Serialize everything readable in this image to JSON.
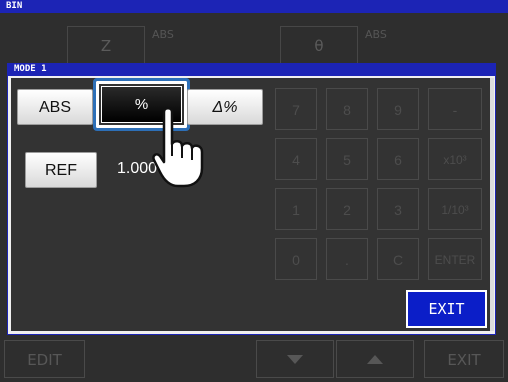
{
  "window": {
    "title": "BIN"
  },
  "background": {
    "param1": {
      "label": "Z",
      "mode": "ABS"
    },
    "param2": {
      "label": "θ",
      "mode": "ABS"
    }
  },
  "dialog": {
    "title": "MODE 1",
    "mode_buttons": {
      "abs": "ABS",
      "percent": "%",
      "delta_percent": "Δ%"
    },
    "ref_label": "REF",
    "ref_value": "1.000",
    "keypad": {
      "row1": [
        "7",
        "8",
        "9",
        "-"
      ],
      "row2": [
        "4",
        "5",
        "6",
        "x10³"
      ],
      "row3": [
        "1",
        "2",
        "3",
        "1/10³"
      ],
      "row4": [
        "0",
        ".",
        "C",
        "ENTER"
      ]
    },
    "exit_label": "EXIT"
  },
  "bottom_bar": {
    "edit": "EDIT",
    "exit": "EXIT"
  },
  "colors": {
    "accent_blue": "#1c24b5",
    "exit_blue": "#0b1ec8",
    "selection_ring": "#2d6fb7"
  },
  "icons": {
    "hand": "pointing-hand-icon",
    "down": "triangle-down-icon",
    "up": "triangle-up-icon"
  }
}
